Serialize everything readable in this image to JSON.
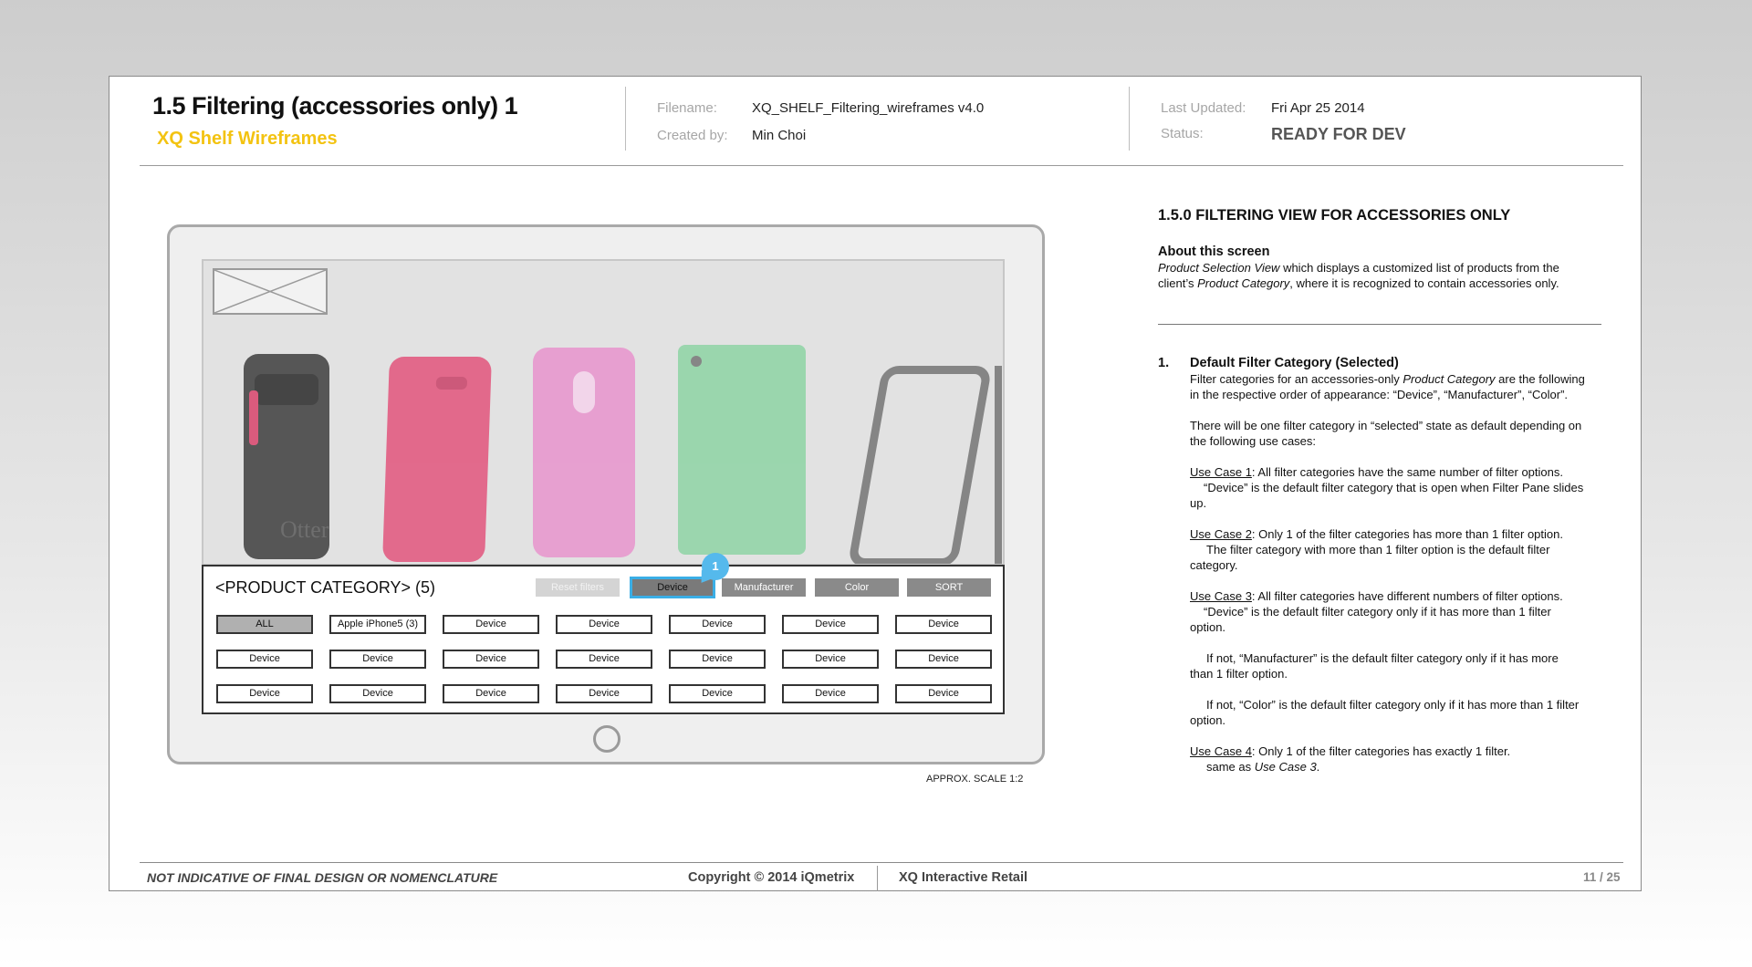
{
  "header": {
    "title": "1.5 Filtering (accessories only) 1",
    "subtitle": "XQ Shelf Wireframes",
    "filename_label": "Filename:",
    "filename": "XQ_SHELF_Filtering_wireframes v4.0",
    "created_label": "Created by:",
    "created_by": "Min Choi",
    "updated_label": "Last Updated:",
    "updated": "Fri Apr 25 2014",
    "status_label": "Status:",
    "status": "READY FOR DEV"
  },
  "wireframe": {
    "category_title": "<PRODUCT CATEGORY> (5)",
    "filter_buttons": [
      "Reset filters",
      "Device",
      "Manufacturer",
      "Color",
      "SORT"
    ],
    "grid_rows": [
      [
        "ALL",
        "Apple iPhone5 (3)",
        "Device",
        "Device",
        "Device",
        "Device",
        "Device"
      ],
      [
        "Device",
        "Device",
        "Device",
        "Device",
        "Device",
        "Device",
        "Device"
      ],
      [
        "Device",
        "Device",
        "Device",
        "Device",
        "Device",
        "Device",
        "Device"
      ]
    ],
    "badge": "1",
    "scale_note": "APPROX. SCALE 1:2",
    "phone_case_text": "Otter",
    "colors": {
      "phone1": "#3e3e3e",
      "phone2": "#e2557c",
      "phone3": "#e894cd",
      "phone4": "#8ed4a4",
      "selected_filter": "#7a7a7a",
      "selected_outline": "#3aaee6",
      "badge": "#55b9ec",
      "subtitle": "#f3c311"
    }
  },
  "notes": {
    "section_title": "1.5.0 FILTERING VIEW FOR ACCESSORIES ONLY",
    "about_heading": "About this screen",
    "about_p1_em": "Product Selection View",
    "about_p1_a": " which displays a customized list of products from the",
    "about_p1_b": "client’s ",
    "about_p1_em2": "Product Category",
    "about_p1_c": ", where it is recognized to contain accessories only.",
    "item_number": "1.",
    "item_heading": "Default Filter Category (Selected)",
    "p1_a": "Filter categories for an accessories-only ",
    "p1_em": "Product Category",
    "p1_b": " are the following",
    "p1_c": "in the respective order of appearance: “Device”, “Manufacturer”, “Color”.",
    "p2_a": "There will be one filter category in “selected” state as default depending on",
    "p2_b": "the following use cases:",
    "uc1_label": "Use Case 1",
    "uc1_a": ": All filter categories have the same number of filter options.",
    "uc1_b": "“Device” is the default filter category that is open when Filter Pane slides",
    "uc1_c": "up.",
    "uc2_label": "Use Case 2",
    "uc2_a": ": Only 1 of the filter categories has more than 1 filter option.",
    "uc2_b": "The filter category with more than 1 filter option is the default filter",
    "uc2_c": "category.",
    "uc3_label": "Use Case 3",
    "uc3_a": ": All filter categories have different numbers of filter options.",
    "uc3_b": "“Device” is the default filter category only if it has more than 1 filter",
    "uc3_c": "option.",
    "uc3_d": "If not,  “Manufacturer” is the default filter category only if it has more",
    "uc3_e": "than 1 filter option.",
    "uc3_f": "If not,  “Color” is the default filter category only if it has more than 1 filter",
    "uc3_g": "option.",
    "uc4_label": "Use Case 4",
    "uc4_a": ": Only 1 of the filter categories has exactly 1 filter.",
    "uc4_b": "same as ",
    "uc4_em": "Use Case 3",
    "uc4_c": "."
  },
  "footer": {
    "disclaimer": "NOT INDICATIVE OF FINAL DESIGN OR NOMENCLATURE",
    "copyright": "Copyright © 2014 iQmetrix",
    "company": "XQ Interactive Retail",
    "page": "11 / 25"
  }
}
